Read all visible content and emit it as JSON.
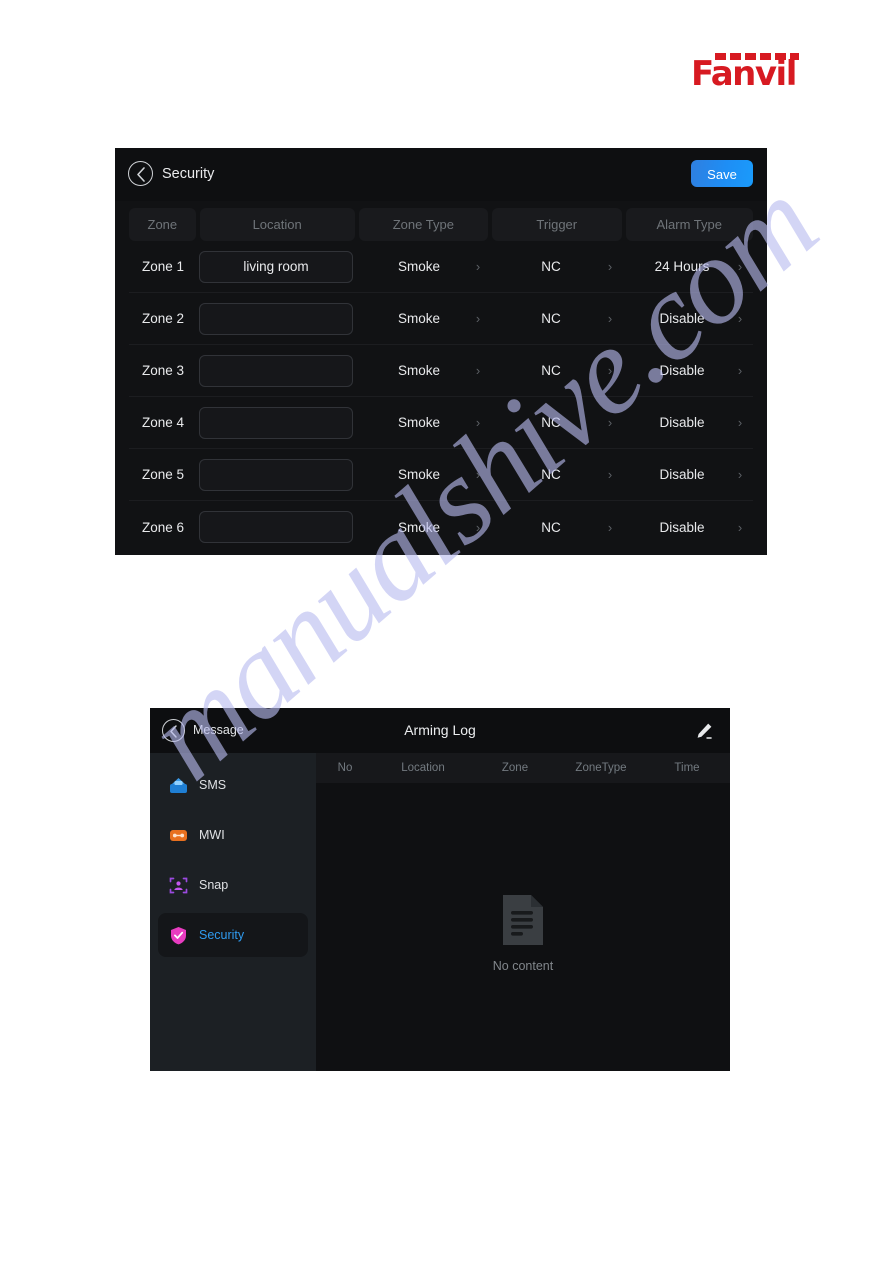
{
  "brand": {
    "name": "Fanvil"
  },
  "watermark": {
    "text": "manualshive.com"
  },
  "security_panel": {
    "back_icon": "chevron-left-icon",
    "title": "Security",
    "save_label": "Save",
    "columns": [
      "Zone",
      "Location",
      "Zone Type",
      "Trigger",
      "Alarm Type"
    ],
    "rows": [
      {
        "zone": "Zone 1",
        "location": "living room",
        "zone_type": "Smoke",
        "trigger": "NC",
        "alarm_type": "24 Hours"
      },
      {
        "zone": "Zone 2",
        "location": "",
        "zone_type": "Smoke",
        "trigger": "NC",
        "alarm_type": "Disable"
      },
      {
        "zone": "Zone 3",
        "location": "",
        "zone_type": "Smoke",
        "trigger": "NC",
        "alarm_type": "Disable"
      },
      {
        "zone": "Zone 4",
        "location": "",
        "zone_type": "Smoke",
        "trigger": "NC",
        "alarm_type": "Disable"
      },
      {
        "zone": "Zone 5",
        "location": "",
        "zone_type": "Smoke",
        "trigger": "NC",
        "alarm_type": "Disable"
      },
      {
        "zone": "Zone 6",
        "location": "",
        "zone_type": "Smoke",
        "trigger": "NC",
        "alarm_type": "Disable"
      }
    ],
    "colors": {
      "save_button": "#1e8ef5",
      "background": "#111214"
    }
  },
  "arming_panel": {
    "back_icon": "chevron-left-icon",
    "back_label": "Message",
    "title": "Arming Log",
    "edit_icon": "pencil-icon",
    "sidebar": [
      {
        "label": "SMS",
        "icon": "sms-envelope-icon",
        "active": false
      },
      {
        "label": "MWI",
        "icon": "mwi-cassette-icon",
        "active": false
      },
      {
        "label": "Snap",
        "icon": "snap-scan-icon",
        "active": false
      },
      {
        "label": "Security",
        "icon": "shield-check-icon",
        "active": true
      }
    ],
    "columns": [
      "No",
      "Location",
      "Zone",
      "ZoneType",
      "Time"
    ],
    "empty_state": {
      "icon": "document-icon",
      "label": "No content"
    },
    "colors": {
      "active_text": "#2f9bf0",
      "shield": "#e43cc4",
      "sidebar_bg": "#1c2024"
    }
  }
}
